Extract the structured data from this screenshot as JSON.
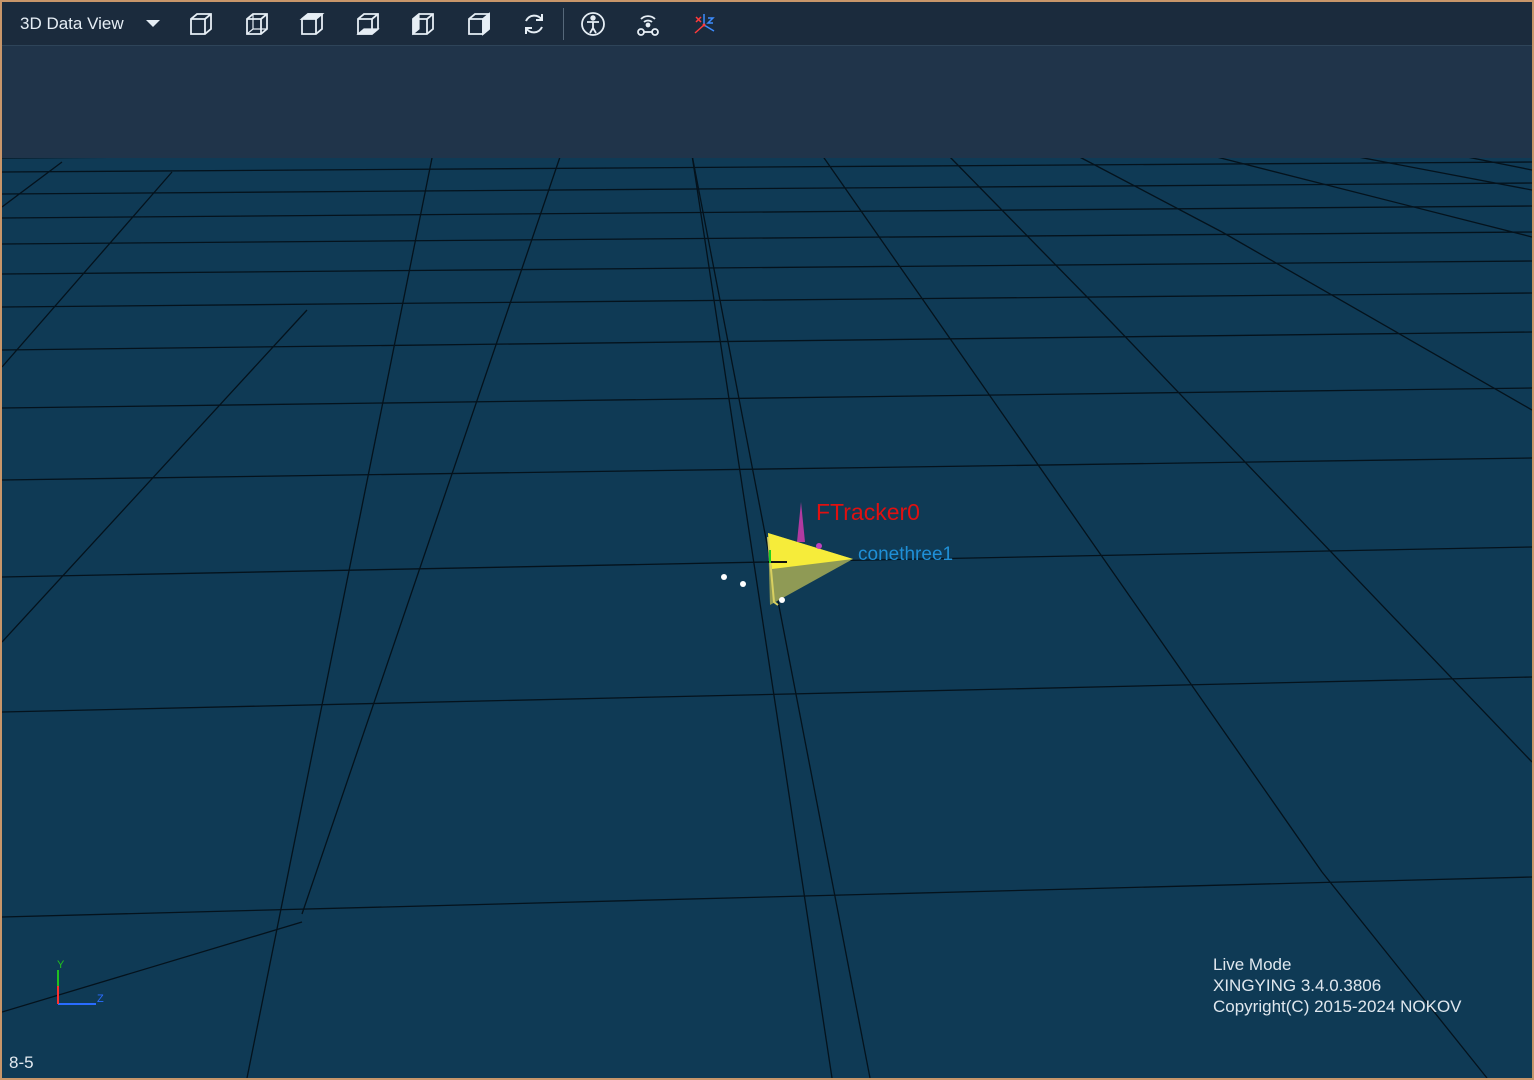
{
  "toolbar": {
    "view_label": "3D Data View",
    "buttons": [
      {
        "name": "view-front-icon"
      },
      {
        "name": "view-back-icon"
      },
      {
        "name": "view-top-icon"
      },
      {
        "name": "view-bottom-icon"
      },
      {
        "name": "view-left-icon"
      },
      {
        "name": "view-right-icon"
      },
      {
        "name": "reset-view-icon"
      },
      {
        "name": "skeleton-icon"
      },
      {
        "name": "tracker-icon"
      },
      {
        "name": "axes-icon"
      }
    ]
  },
  "scene": {
    "tracker_label": "FTracker0",
    "rigid_body_label": "conethree1",
    "axis_labels": {
      "y": "Y",
      "z": "Z"
    }
  },
  "info": {
    "mode": "Live Mode",
    "version": "XINGYING 3.4.0.3806",
    "copyright": "Copyright(C) 2015-2024 NOKOV"
  },
  "corner_label": "8-5",
  "colors": {
    "floor": "#0f3a55",
    "sky": "#20344a",
    "toolbar": "#1b2b3d",
    "frame": "#c8966a",
    "tracker_label": "#e01010",
    "rigid_body_label": "#1f8fd6"
  }
}
